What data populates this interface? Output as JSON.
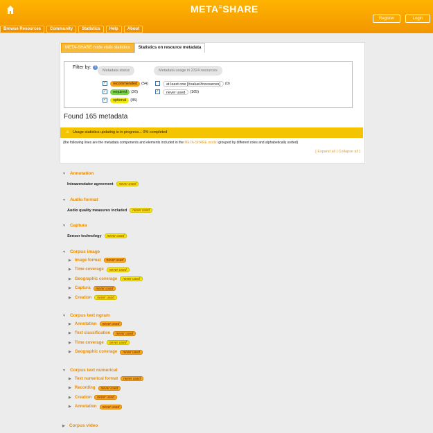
{
  "header": {
    "logo": "META",
    "logo_suffix": "SHARE",
    "register": "Register",
    "login": "Login"
  },
  "nav": [
    "Browse Resources",
    "Community",
    "Statistics",
    "Help",
    "About"
  ],
  "tabs": [
    "META-SHARE node visits statistics",
    "Statistics on resource metadata"
  ],
  "filter": {
    "label": "Filter by:",
    "col1_head": "Metadata status",
    "col2_head": "Metadata usage in 2324 resources",
    "status": [
      {
        "label": "recommended",
        "count": "(54)",
        "color": "#f6a21a",
        "checked": true
      },
      {
        "label": "required",
        "count": "(26)",
        "color": "#7ad24b",
        "checked": true
      },
      {
        "label": "optional",
        "count": "(85)",
        "color": "#f2e60f",
        "checked": true
      }
    ],
    "usage": [
      {
        "label": "at least one [#value/#resources]",
        "count": "(0)",
        "checked": false
      },
      {
        "label": "never used",
        "count": "(165)",
        "checked": true
      }
    ]
  },
  "found": "Found 165 metadata",
  "progress": "Usage statistics updating is in progress... 0% completed",
  "note_pre": "(the following lines are the metadata components and elements included in the",
  "note_link": "META-SHARE model",
  "note_post": "grouped by different roles and alphabetically sorted)",
  "expand_all": "Expand all",
  "collapse_all": "Collapse all",
  "never_used": "never used",
  "sections": [
    {
      "title": "Annotation",
      "leaf": "Intraannotator agreement"
    },
    {
      "title": "Audio format",
      "leaf": "Audio quality measures included"
    },
    {
      "title": "Captura",
      "leaf": "Sensor technology"
    },
    {
      "title": "Corpus image",
      "subs": [
        "Image format",
        "Time coverage",
        "Geographic coverage",
        "Captura",
        "Creation"
      ]
    },
    {
      "title": "Corpus text ngram",
      "subs": [
        "Annotation",
        "Text classification",
        "Time coverage",
        "Geographic coverage"
      ]
    },
    {
      "title": "Corpus text numerical",
      "subs": [
        "Text numerical format",
        "Recording",
        "Creation",
        "Annotation"
      ]
    },
    {
      "title": "Corpus video"
    }
  ]
}
